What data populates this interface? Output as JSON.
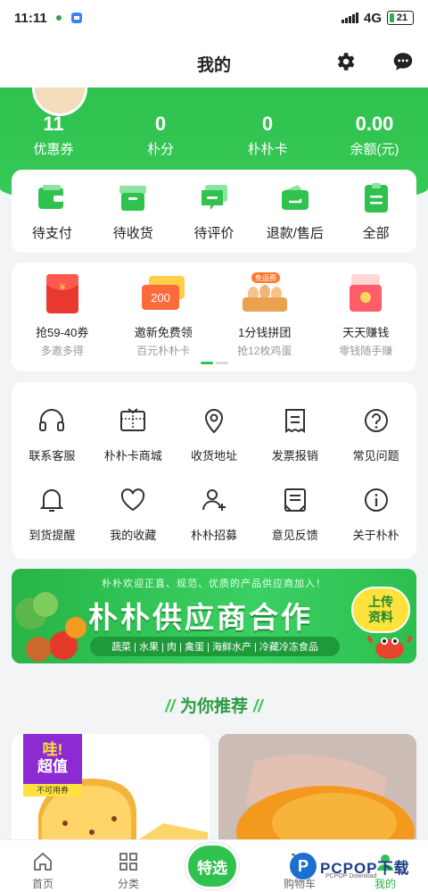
{
  "status_bar": {
    "time": "11:11",
    "network": "4G",
    "battery": "21"
  },
  "header": {
    "title": "我的"
  },
  "stats": [
    {
      "value": "11",
      "label": "优惠券"
    },
    {
      "value": "0",
      "label": "朴分"
    },
    {
      "value": "0",
      "label": "朴朴卡"
    },
    {
      "value": "0.00",
      "label": "余额(元)"
    }
  ],
  "orders": [
    {
      "label": "待支付",
      "icon": "wallet-icon"
    },
    {
      "label": "待收货",
      "icon": "package-icon"
    },
    {
      "label": "待评价",
      "icon": "comment-icon"
    },
    {
      "label": "退款/售后",
      "icon": "refund-icon"
    },
    {
      "label": "全部",
      "icon": "list-icon"
    }
  ],
  "promos": [
    {
      "title": "抢59-40券",
      "sub": "多邀多得",
      "icon": "red-envelope-icon"
    },
    {
      "title": "邀新免费领",
      "sub": "百元朴朴卡",
      "icon": "gift-card-icon",
      "tag": "200"
    },
    {
      "title": "1分钱拼团",
      "sub": "抢12枚鸡蛋",
      "icon": "eggs-icon",
      "tag": "免运费"
    },
    {
      "title": "天天赚钱",
      "sub": "零钱随手赚",
      "icon": "money-icon"
    }
  ],
  "services": [
    {
      "label": "联系客服",
      "icon": "headset-icon"
    },
    {
      "label": "朴朴卡商城",
      "icon": "gift-icon"
    },
    {
      "label": "收货地址",
      "icon": "location-icon"
    },
    {
      "label": "发票报销",
      "icon": "invoice-icon"
    },
    {
      "label": "常见问题",
      "icon": "question-icon"
    },
    {
      "label": "到货提醒",
      "icon": "bell-icon"
    },
    {
      "label": "我的收藏",
      "icon": "heart-icon"
    },
    {
      "label": "朴朴招募",
      "icon": "recruit-icon"
    },
    {
      "label": "意见反馈",
      "icon": "feedback-icon"
    },
    {
      "label": "关于朴朴",
      "icon": "info-icon"
    }
  ],
  "banner": {
    "top": "朴朴欢迎正直、规范、优质的产品供应商加入！",
    "main": "朴朴供应商合作",
    "cats": "蔬菜 | 水果 | 肉 | 禽蛋 | 海鲜水产 | 冷藏冷冻食品",
    "button_line1": "上传",
    "button_line2": "资料"
  },
  "recommend": {
    "title": "为你推荐"
  },
  "products": [
    {
      "badge_line1": "哇!",
      "badge_line2": "超值",
      "badge_note": "不可用券"
    },
    {}
  ],
  "tabbar": [
    {
      "label": "首页",
      "icon": "home-icon"
    },
    {
      "label": "分类",
      "icon": "grid-icon"
    },
    {
      "label": "特选",
      "icon": "featured-icon"
    },
    {
      "label": "购物车",
      "icon": "cart-icon"
    },
    {
      "label": "我的",
      "icon": "user-icon",
      "active": true
    }
  ],
  "watermark": {
    "logo": "P",
    "text": "PCPOP下载",
    "sub": "PCPOP Download"
  },
  "colors": {
    "brand_green": "#2fc24e",
    "accent_purple": "#8b2bd1",
    "muted": "#999999"
  }
}
